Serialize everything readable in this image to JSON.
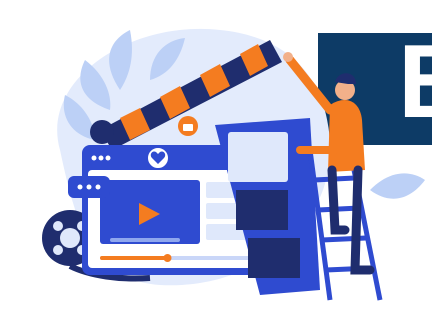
{
  "banner": {
    "letter": "B",
    "color": "#0d3b66"
  },
  "colors": {
    "primary_blue": "#2f4bd0",
    "light_blue": "#dfe8fb",
    "orange": "#f47c20",
    "navy": "#1f2d6e",
    "skin": "#f2b08a"
  },
  "media": {
    "progress_fraction": 0.45
  },
  "icons": [
    "play-icon",
    "heart-icon",
    "thumbs-up-icon",
    "chat-bubble-icon",
    "film-reel-icon",
    "clapperboard-icon",
    "ladder-icon"
  ]
}
